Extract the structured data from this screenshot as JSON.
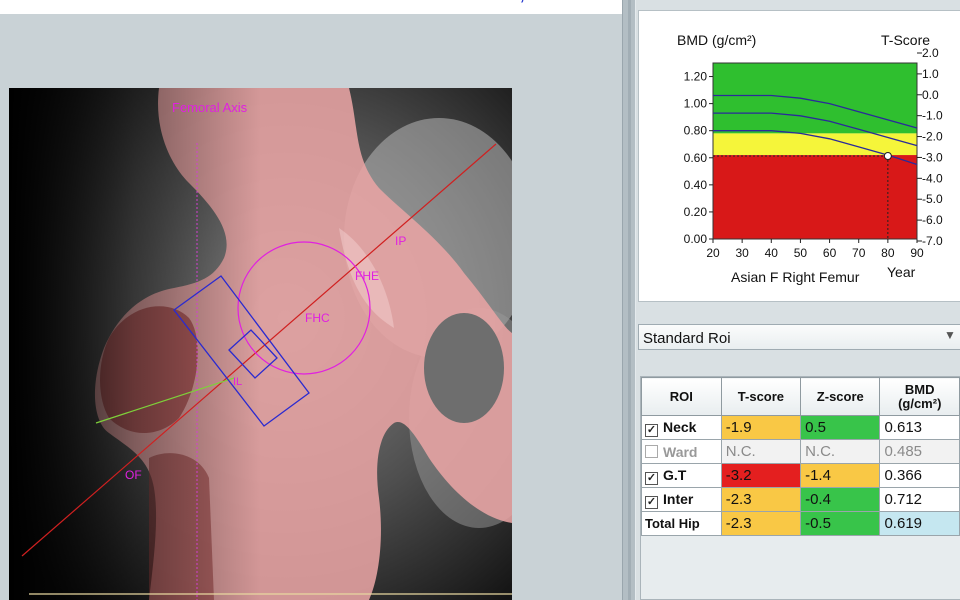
{
  "header": {
    "marks": [
      "’",
      "’"
    ]
  },
  "scan": {
    "labels": {
      "femoral_axis": "Femoral Axis",
      "ip": "IP",
      "fhe": "FHE",
      "fhc": "FHC",
      "il": "IL",
      "of": "OF"
    },
    "colors": {
      "bone_overlay": "#e8a4a4",
      "label": "#e020e0",
      "axis": "#d02020",
      "neck_line": "#7ed03a",
      "roi_box": "#2a2ad0"
    }
  },
  "chart": {
    "left_label": "BMD (g/cm²)",
    "right_label": "T-Score",
    "caption": "Asian F Right Femur",
    "x_axis_label": "Year",
    "chart_data": {
      "type": "line",
      "x_ticks": [
        20,
        30,
        40,
        50,
        60,
        70,
        80,
        90
      ],
      "y_left_ticks": [
        "0.00",
        "0.20",
        "0.40",
        "0.60",
        "0.80",
        "1.00",
        "1.20"
      ],
      "y_right_ticks": [
        "-7.0",
        "-6.0",
        "-5.0",
        "-4.0",
        "-3.0",
        "-2.0",
        "-1.0",
        "0.0",
        "1.0",
        "2.0"
      ],
      "xlim": [
        20,
        90
      ],
      "ylim": [
        0,
        1.3
      ],
      "zones": [
        {
          "name": "green",
          "from": 0.78,
          "to": 1.3,
          "color": "#2fbf2f"
        },
        {
          "name": "yellow",
          "from": 0.62,
          "to": 0.78,
          "color": "#f5f53a"
        },
        {
          "name": "red",
          "from": 0.0,
          "to": 0.62,
          "color": "#d81818"
        }
      ],
      "series": [
        {
          "x": [
            20,
            30,
            40,
            50,
            60,
            70,
            80,
            90
          ],
          "y": [
            1.06,
            1.06,
            1.06,
            1.04,
            1.0,
            0.94,
            0.88,
            0.82
          ]
        },
        {
          "x": [
            20,
            30,
            40,
            50,
            60,
            70,
            80,
            90
          ],
          "y": [
            0.93,
            0.93,
            0.93,
            0.91,
            0.87,
            0.81,
            0.75,
            0.69
          ]
        },
        {
          "x": [
            20,
            30,
            40,
            50,
            60,
            70,
            80,
            90
          ],
          "y": [
            0.8,
            0.8,
            0.8,
            0.78,
            0.74,
            0.68,
            0.62,
            0.55
          ]
        }
      ],
      "patient_point": {
        "x": 80,
        "y": 0.613
      }
    }
  },
  "roi_dropdown": {
    "value": "Standard Roi"
  },
  "results": {
    "headers": [
      "ROI",
      "T-score",
      "Z-score",
      "BMD\n(g/cm²)"
    ],
    "rows": [
      {
        "roi": "Neck",
        "checked": true,
        "tscore": "-1.9",
        "zscore": "0.5",
        "bmd": "0.613"
      },
      {
        "roi": "Ward",
        "checked": false,
        "tscore": "N.C.",
        "zscore": "N.C.",
        "bmd": "0.485"
      },
      {
        "roi": "G.T",
        "checked": true,
        "tscore": "-3.2",
        "zscore": "-1.4",
        "bmd": "0.366"
      },
      {
        "roi": "Inter",
        "checked": true,
        "tscore": "-2.3",
        "zscore": "-0.4",
        "bmd": "0.712"
      },
      {
        "roi": "Total Hip",
        "tscore": "-2.3",
        "zscore": "-0.5",
        "bmd": "0.619"
      }
    ]
  }
}
